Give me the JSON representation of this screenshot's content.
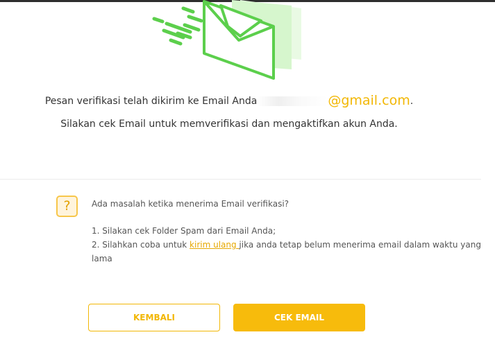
{
  "verification": {
    "line1_prefix": "Pesan verifikasi telah dikirim ke Email Anda",
    "email_domain": "@gmail.com",
    "line1_suffix": ".",
    "line2": "Silakan cek Email untuk memverifikasi dan mengaktifkan akun Anda."
  },
  "help": {
    "icon_symbol": "?",
    "title": "Ada masalah ketika menerima Email verifikasi?",
    "item1": "1. Silakan cek Folder Spam dari Email Anda;",
    "item2_prefix": "2. Silahkan coba untuk ",
    "item2_link": "kirim ulang ",
    "item2_suffix": "jika anda tetap belum menerima email dalam waktu yang",
    "item2_cont": "lama"
  },
  "buttons": {
    "back_label": "KEMBALI",
    "check_email_label": "CEK EMAIL"
  },
  "colors": {
    "accent": "#f7bb0c",
    "illustration_green": "#5ccf4c",
    "illustration_light_green": "#d5f5cd"
  },
  "icons": {
    "illustration": "mail-sent-envelope-icon",
    "help": "question-icon"
  }
}
